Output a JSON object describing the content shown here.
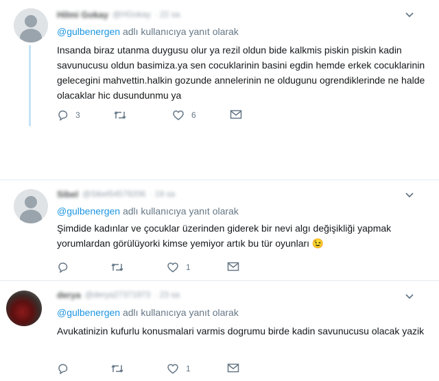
{
  "tweets": [
    {
      "name": "Hilmi Gokay",
      "handle": "@HGokay",
      "time": "· 22 sa",
      "reply_prefix": "@gulbenergen",
      "reply_suffix": " adlı kullanıcıya yanıt olarak",
      "text": "Insanda biraz utanma duygusu olur ya rezil oldun bide kalkmis piskin piskin kadin savunucusu oldun basimiza.ya sen cocuklarinin basini egdin hemde erkek cocuklarinin gelecegini mahvettin.halkin gozunde annelerinin ne oldugunu ogrendiklerinde ne halde olacaklar hic dusundunmu ya",
      "reply_count": "3",
      "retweet_count": "",
      "like_count": "6",
      "avatar": "default"
    },
    {
      "name": "Sibel",
      "handle": "@Sibel54579206",
      "time": "· 19 sa",
      "reply_prefix": "@gulbenergen",
      "reply_suffix": " adlı kullanıcıya yanıt olarak",
      "text": "Şimdide kadınlar ve çocuklar üzerinden giderek bir nevi algı değişikliği yapmak yorumlardan görülüyorki  kimse yemiyor artık bu tür oyunları 😉",
      "reply_count": "",
      "retweet_count": "",
      "like_count": "1",
      "avatar": "default"
    },
    {
      "name": "derya",
      "handle": "@derya27371973",
      "time": "· 23 sa",
      "reply_prefix": "@gulbenergen",
      "reply_suffix": " adlı kullanıcıya yanıt olarak",
      "text": "Avukatinizin kufurlu konusmalari varmis dogrumu birde kadin savunucusu olacak yazik",
      "reply_count": "",
      "retweet_count": "",
      "like_count": "1",
      "avatar": "photo"
    }
  ],
  "icons": {
    "reply": "reply-bubble-icon",
    "retweet": "retweet-icon",
    "like": "heart-icon",
    "message": "envelope-icon",
    "more": "chevron-down-icon"
  },
  "colors": {
    "link": "#1b95e0",
    "muted": "#657786",
    "thread": "#c4e3f7",
    "divider": "#e6ecf0"
  }
}
